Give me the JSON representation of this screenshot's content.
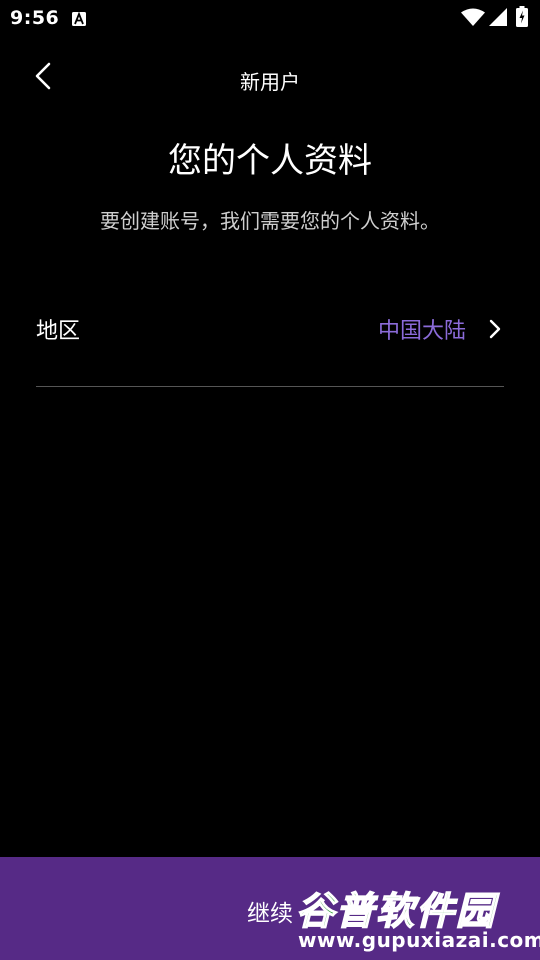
{
  "status_bar": {
    "time": "9:56",
    "icons": [
      "notification-a-icon",
      "wifi-icon",
      "signal-icon",
      "battery-charging-icon"
    ]
  },
  "nav": {
    "back_icon": "chevron-left-icon",
    "title": "新用户"
  },
  "header": {
    "title": "您的个人资料",
    "subtitle": "要创建账号，我们需要您的个人资料。"
  },
  "form": {
    "region": {
      "label": "地区",
      "value": "中国大陆",
      "icon": "chevron-right-icon"
    }
  },
  "footer": {
    "continue_label": "继续"
  },
  "watermark": {
    "chinese": "谷普软件园",
    "url": "www.gupuxiazai.com"
  },
  "colors": {
    "background": "#000000",
    "accent": "#8b6bd9",
    "button_bar": "#562a86",
    "divider": "#555555"
  }
}
